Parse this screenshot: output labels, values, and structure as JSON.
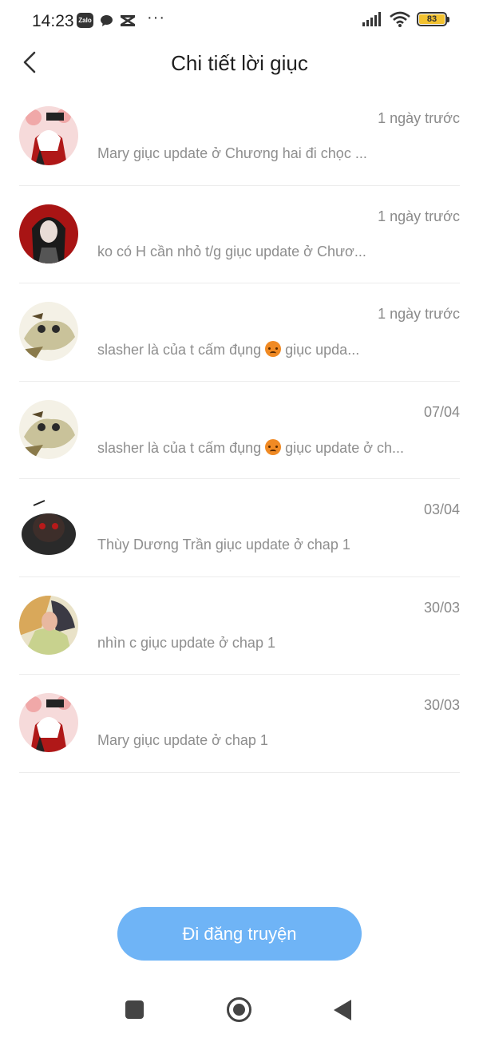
{
  "status_bar": {
    "time": "14:23",
    "zalo_label": "Zalo",
    "dots": "···",
    "battery_level": "83",
    "icons": [
      "zalo-icon",
      "message-icon",
      "capcut-icon",
      "signal-icon",
      "wifi-icon",
      "battery-icon"
    ]
  },
  "header": {
    "title": "Chi tiết lời giục",
    "back_icon": "chevron-left-icon"
  },
  "items": [
    {
      "avatar": "avatar-pink-hair",
      "time": "1 ngày trước",
      "text": "Mary giục update ở Chương hai đi chọc ...",
      "emoji": false
    },
    {
      "avatar": "avatar-dark-hair-red-bg",
      "time": "1 ngày trước",
      "text": "ko có H cần nhỏ t/g giục update ở Chươ...",
      "emoji": false
    },
    {
      "avatar": "avatar-beige-creature",
      "time": "1 ngày trước",
      "text_before": "slasher là của t cấm đụng ",
      "text_after": " giục upda...",
      "emoji": true
    },
    {
      "avatar": "avatar-beige-creature",
      "time": "07/04",
      "text_before": "slasher là của t cấm đụng ",
      "text_after": " giục update ở ch...",
      "emoji": true
    },
    {
      "avatar": "avatar-dark-mask",
      "time": "03/04",
      "text": "Thùy Dương Trần giục update ở chap 1",
      "emoji": false
    },
    {
      "avatar": "avatar-couple-art",
      "time": "30/03",
      "text": "nhìn c giục update ở chap 1",
      "emoji": false
    },
    {
      "avatar": "avatar-pink-hair",
      "time": "30/03",
      "text": "Mary giục update ở chap 1",
      "emoji": false
    }
  ],
  "cta": {
    "label": "Đi đăng truyện"
  },
  "nav": {
    "icons": [
      "recent-apps-icon",
      "home-icon",
      "back-triangle-icon"
    ]
  },
  "colors": {
    "accent": "#6fb4f6",
    "secondary_text": "#8e8e8e",
    "divider": "#ececec"
  }
}
